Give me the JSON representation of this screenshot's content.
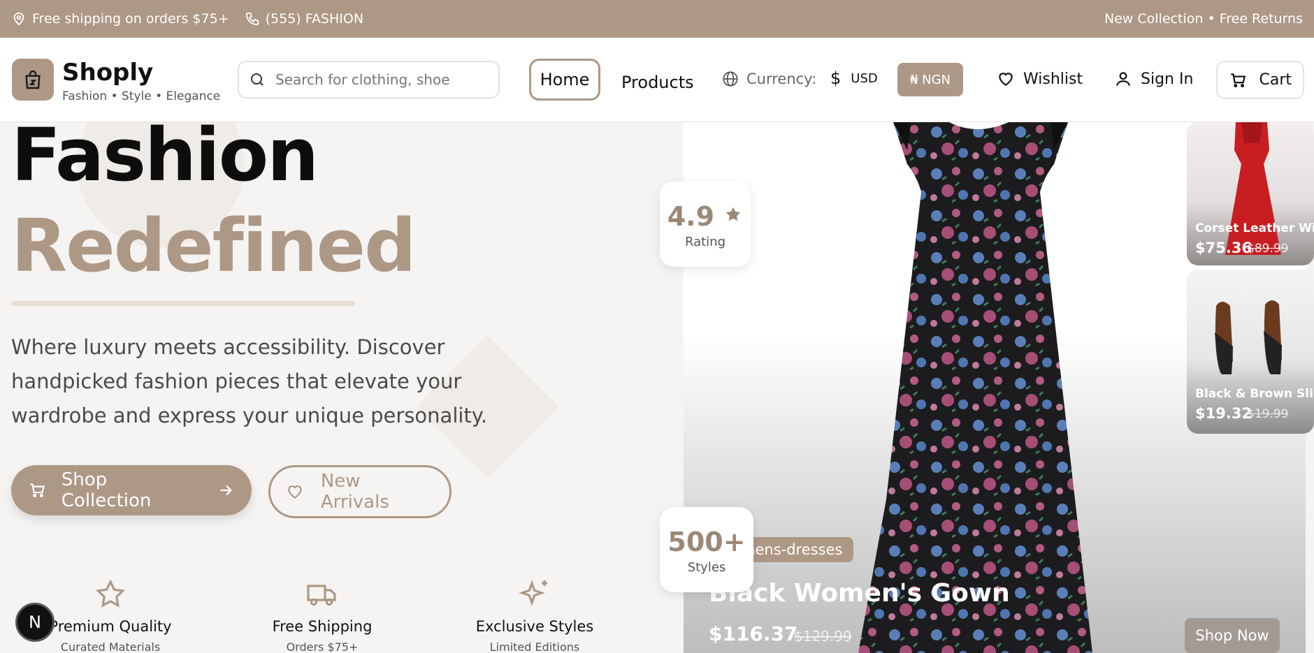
{
  "promo": {
    "shipping": "Free shipping on orders $75+",
    "phone": "(555) FASHION",
    "right": "New Collection • Free Returns"
  },
  "header": {
    "brand": "Shoply",
    "tagline": "Fashion • Style • Elegance",
    "search_placeholder": "Search for clothing, shoes, a",
    "nav_home": "Home",
    "nav_products": "Products",
    "currency_label": "Currency:",
    "currency_usd": "USD",
    "currency_usd_symbol": "$",
    "currency_ngn": "₦ NGN",
    "wishlist": "Wishlist",
    "signin": "Sign In",
    "cart": "Cart"
  },
  "hero": {
    "title_line1": "Fashion",
    "title_line2": "Redefined",
    "description": "Where luxury meets accessibility. Discover handpicked fashion pieces that elevate your wardrobe and express your unique personality.",
    "btn_shop": "Shop Collection",
    "btn_new": "New Arrivals",
    "features": [
      {
        "title": "Premium Quality",
        "subtitle": "Curated Materials"
      },
      {
        "title": "Free Shipping",
        "subtitle": "Orders $75+"
      },
      {
        "title": "Exclusive Styles",
        "subtitle": "Limited Editions"
      }
    ]
  },
  "stats": {
    "rating_value": "4.9",
    "rating_label": "Rating",
    "styles_value": "500+",
    "styles_label": "Styles"
  },
  "featured": {
    "category": "womens-dresses",
    "title": "Black Women's Gown",
    "price": "$116.37",
    "old_price": "$129.99",
    "cta": "Shop Now"
  },
  "side_products": [
    {
      "name": "Corset Leather Wit...",
      "price": "$75.36",
      "old_price": "$89.99"
    },
    {
      "name": "Black & Brown Slip...",
      "price": "$19.32",
      "old_price": "$19.99"
    }
  ],
  "dev_badge": "N",
  "colors": {
    "accent": "#ad9886",
    "dark": "#111111"
  }
}
